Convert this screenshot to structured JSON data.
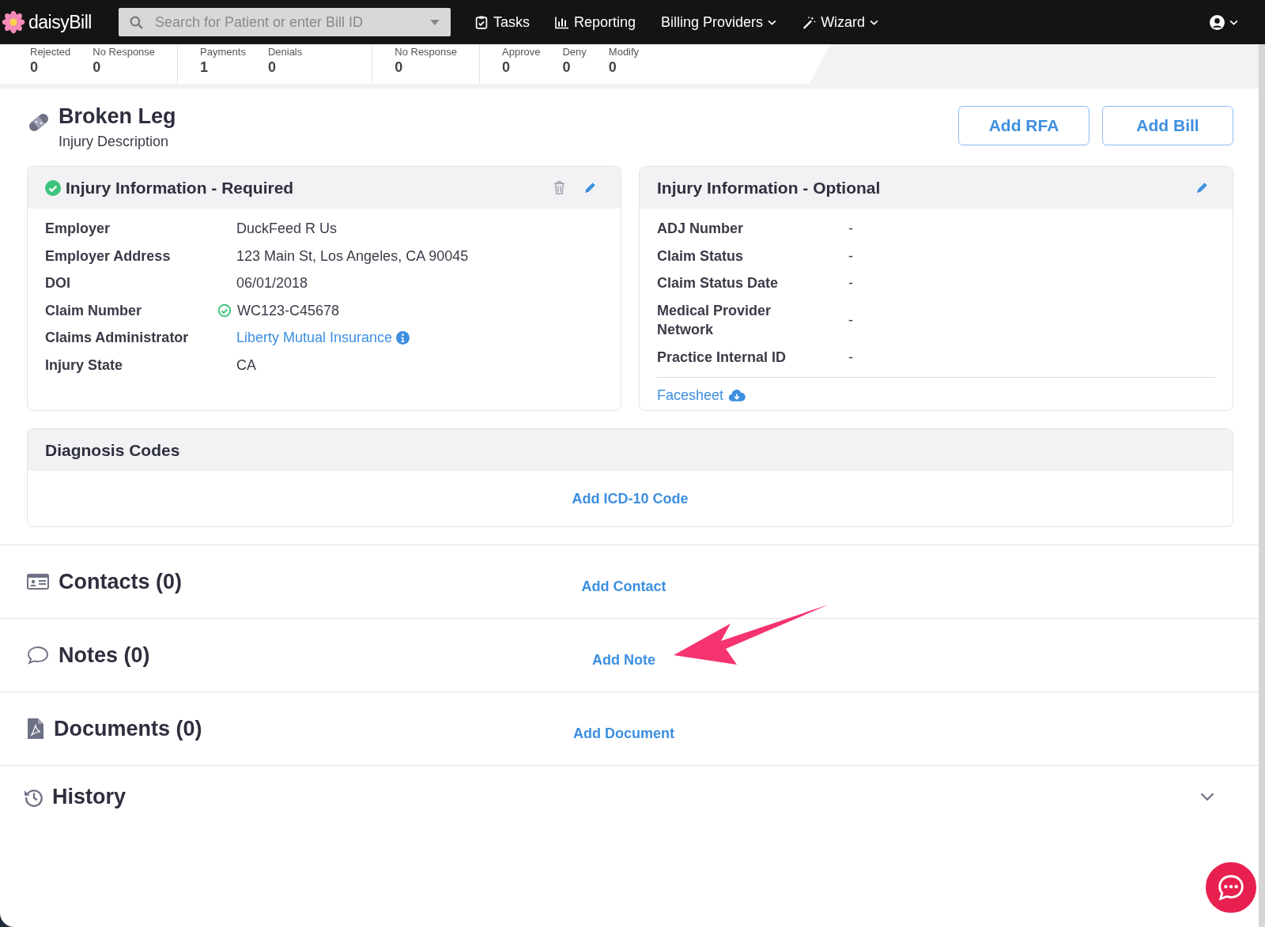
{
  "nav": {
    "logo": "daisyBill",
    "search": {
      "placeholder": "Search for Patient or enter Bill ID"
    },
    "items": [
      {
        "label": "Tasks",
        "kind": "tasks"
      },
      {
        "label": "Reporting",
        "kind": "reporting"
      },
      {
        "label": "Billing Providers",
        "kind": "dropdown"
      },
      {
        "label": "Wizard",
        "kind": "wizard"
      }
    ]
  },
  "stats": [
    [
      {
        "label": "Rejected",
        "value": "0"
      },
      {
        "label": "No Response",
        "value": "0"
      }
    ],
    [
      {
        "label": "Payments",
        "value": "1"
      },
      {
        "label": "Denials",
        "value": "0"
      }
    ],
    [
      {
        "label": "No Response",
        "value": "0"
      }
    ],
    [
      {
        "label": "Approve",
        "value": "0"
      },
      {
        "label": "Deny",
        "value": "0"
      },
      {
        "label": "Modify",
        "value": "0"
      }
    ]
  ],
  "injury": {
    "title": "Broken Leg",
    "subtitle": "Injury Description",
    "buttons": [
      "Add RFA",
      "Add Bill"
    ]
  },
  "cards": [
    {
      "title": "Injury Information - Required",
      "verified": true,
      "deletable": true,
      "fields": [
        {
          "label": "Employer",
          "value": "DuckFeed R Us",
          "kind": "text",
          "verified": false
        },
        {
          "label": "Employer Address",
          "value": "123 Main St, Los Angeles, CA 90045",
          "kind": "text",
          "verified": false
        },
        {
          "label": "DOI",
          "value": "06/01/2018",
          "kind": "text",
          "verified": false
        },
        {
          "label": "Claim Number",
          "value": "WC123-C45678",
          "kind": "text",
          "verified": true
        },
        {
          "label": "Claims Administrator",
          "value": "Liberty Mutual Insurance",
          "kind": "link",
          "verified": false
        },
        {
          "label": "Injury State",
          "value": "CA",
          "kind": "text",
          "verified": false
        }
      ]
    },
    {
      "title": "Injury Information - Optional",
      "verified": false,
      "deletable": false,
      "fields": [
        {
          "label": "ADJ Number",
          "value": "-",
          "kind": "text",
          "verified": false
        },
        {
          "label": "Claim Status",
          "value": "-",
          "kind": "text",
          "verified": false
        },
        {
          "label": "Claim Status Date",
          "value": "-",
          "kind": "text",
          "verified": false
        },
        {
          "label": "Medical Provider Network",
          "value": "-",
          "kind": "text",
          "verified": false
        },
        {
          "label": "Practice Internal ID",
          "value": "-",
          "kind": "text",
          "verified": false
        }
      ],
      "link": "Facesheet"
    }
  ],
  "diagnosis": {
    "title": "Diagnosis Codes",
    "action": "Add ICD-10 Code"
  },
  "sections": [
    {
      "title": "Contacts (0)",
      "action": "Add Contact",
      "kind": "contacts"
    },
    {
      "title": "Notes (0)",
      "action": "Add Note",
      "kind": "notes"
    },
    {
      "title": "Documents (0)",
      "action": "Add Document",
      "kind": "documents"
    }
  ],
  "history": {
    "title": "History",
    "expanded": false
  }
}
